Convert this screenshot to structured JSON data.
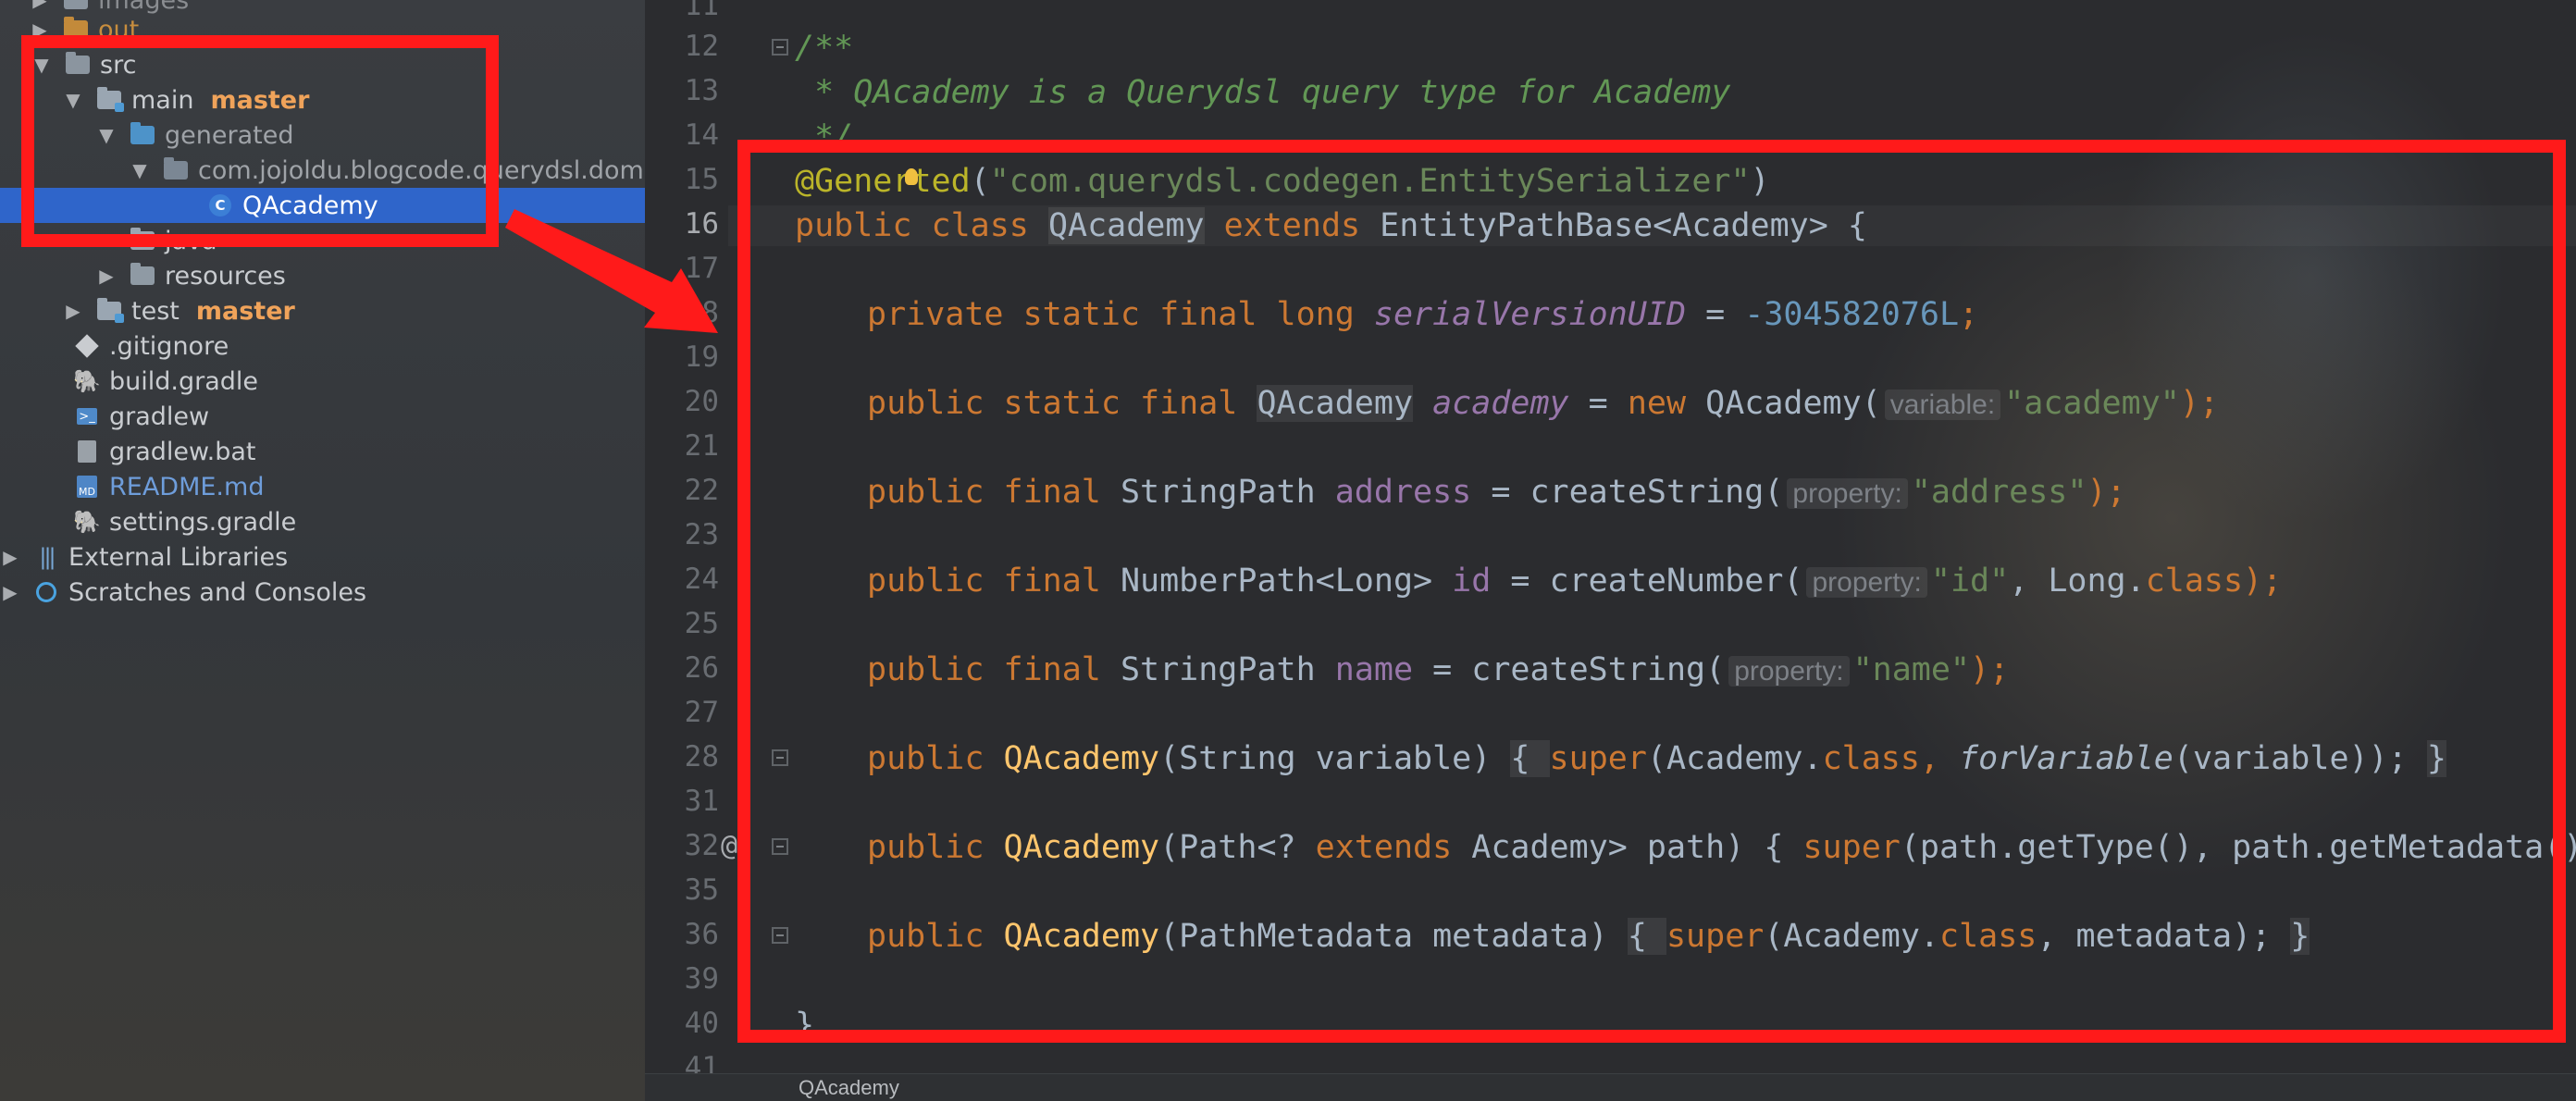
{
  "colors": {
    "annotation_red": "#ff1a1a",
    "branch_orange": "#f0a35a",
    "selection_blue": "#2f65ca"
  },
  "project_tree": {
    "items": [
      {
        "label": "images",
        "icon": "folder-icon"
      },
      {
        "label": "out",
        "icon": "out-folder-icon"
      },
      {
        "label": "src",
        "icon": "folder-icon"
      },
      {
        "label": "main",
        "branch": "master",
        "icon": "source-module-folder-icon"
      },
      {
        "label": "generated",
        "icon": "generated-folder-icon"
      },
      {
        "label": "com.jojoldu.blogcode.querydsl.dom",
        "icon": "package-icon"
      },
      {
        "label": "QAcademy",
        "icon": "class-icon"
      },
      {
        "label": "java",
        "icon": "source-folder-icon"
      },
      {
        "label": "resources",
        "icon": "resources-folder-icon"
      },
      {
        "label": "test",
        "branch": "master",
        "icon": "test-module-folder-icon"
      },
      {
        "label": ".gitignore",
        "icon": "git-icon"
      },
      {
        "label": "build.gradle",
        "icon": "gradle-icon"
      },
      {
        "label": "gradlew",
        "icon": "terminal-icon"
      },
      {
        "label": "gradlew.bat",
        "icon": "file-icon"
      },
      {
        "label": "README.md",
        "icon": "markdown-icon"
      },
      {
        "label": "settings.gradle",
        "icon": "gradle-icon"
      },
      {
        "label": "External Libraries",
        "icon": "libraries-icon"
      },
      {
        "label": "Scratches and Consoles",
        "icon": "scratches-icon"
      }
    ],
    "class_icon_glyph": "C",
    "md_icon_glyph": "MD",
    "term_icon_glyph": ">_"
  },
  "editor": {
    "line_numbers": [
      "11",
      "12",
      "13",
      "14",
      "15",
      "16",
      "17",
      "18",
      "19",
      "20",
      "21",
      "22",
      "23",
      "24",
      "25",
      "26",
      "27",
      "28",
      "31",
      "32",
      "35",
      "36",
      "39",
      "40",
      "41"
    ],
    "current_line": "16",
    "marker_glyph": "@",
    "lines": {
      "l12": "/**",
      "l13": " * QAcademy is a Querydsl query type for Academy",
      "l14": " */",
      "l15_ann_a": "@Gener",
      "l15_ann_b": "ted",
      "l15_open": "(",
      "l15_str": "\"com.querydsl.codegen.EntitySerializer\"",
      "l15_close": ")",
      "l16_kw": "public class ",
      "l16_cls": "QAcademy",
      "l16_ext": " extends ",
      "l16_rest": "EntityPathBase<Academy> {",
      "l18_kw": "private static final long ",
      "l18_fld": "serialVersionUID",
      "l18_eq": " = ",
      "l18_num": "-304582076L",
      "l18_semi": ";",
      "l20_kw": "public static final ",
      "l20_type": "QAcademy",
      "l20_sp": " ",
      "l20_fld": "academy",
      "l20_eq": " = ",
      "l20_new": "new ",
      "l20_ctor": "QAcademy",
      "l20_paren": "(",
      "l20_hint": "variable:",
      "l20_str": "\"academy\"",
      "l20_end": ");",
      "l22_kw": "public final ",
      "l22_type": "StringPath ",
      "l22_fld": "address",
      "l22_call": " = createString(",
      "l22_hint": "property:",
      "l22_str": "\"address\"",
      "l22_end": ");",
      "l24_kw": "public final ",
      "l24_type": "NumberPath<Long> ",
      "l24_fld": "id",
      "l24_call": " = createNumber(",
      "l24_hint": "property:",
      "l24_str": "\"id\"",
      "l24_comma": ", Long.",
      "l24_cls": "class",
      "l24_end": ");",
      "l26_kw": "public final ",
      "l26_type": "StringPath ",
      "l26_fld": "name",
      "l26_call": " = createString(",
      "l26_hint": "property:",
      "l26_str": "\"name\"",
      "l26_end": ");",
      "l28_kw": "public ",
      "l28_mth": "QAcademy",
      "l28_args": "(String variable) ",
      "l28_ob": "{ ",
      "l28_super": "super",
      "l28_a": "(Academy.",
      "l28_cls": "class",
      "l28_b": ", ",
      "l28_fv": "forVariable",
      "l28_c": "(variable)); ",
      "l28_cb": "}",
      "l32_kw": "public ",
      "l32_mth": "QAcademy",
      "l32_a": "(Path<? ",
      "l32_ext": "extends",
      "l32_b": " Academy> path) { ",
      "l32_super": "super",
      "l32_c": "(path.getType(), path.getMetadata()); ",
      "l36_kw": "public ",
      "l36_mth": "QAcademy",
      "l36_a": "(PathMetadata metadata) ",
      "l36_ob": "{ ",
      "l36_super": "super",
      "l36_b": "(Academy.",
      "l36_cls": "class",
      "l36_c": ", metadata); ",
      "l36_cb": "}",
      "l40": "}"
    },
    "breadcrumb": "QAcademy"
  }
}
